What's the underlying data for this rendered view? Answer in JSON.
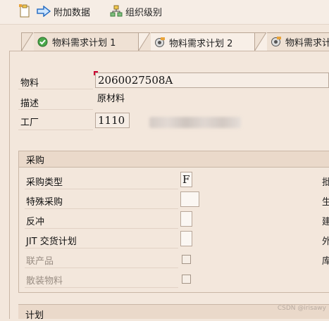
{
  "toolbar": {
    "add_data_label": "附加数据",
    "org_levels_label": "组织级别"
  },
  "tabs": [
    {
      "label": "物料需求计划 1"
    },
    {
      "label": "物料需求计划 2"
    },
    {
      "label": "物料需求计"
    }
  ],
  "header": {
    "material_label": "物料",
    "material_value": "2060027508A",
    "description_label": "描述",
    "description_value": "原材料",
    "plant_label": "工厂",
    "plant_value": "1110"
  },
  "procurement": {
    "title": "采购",
    "type_label": "采购类型",
    "type_value": "F",
    "special_label": "特殊采购",
    "special_value": "",
    "backflush_label": "反冲",
    "jit_label": "JIT 交货计划",
    "coproduct_label": "联产品",
    "bulk_label": "散装物料",
    "right_fragments": [
      "批",
      "生",
      "建",
      "外",
      "库"
    ]
  },
  "next_group": {
    "title": "计划"
  },
  "watermark": "CSDN @irisawy"
}
